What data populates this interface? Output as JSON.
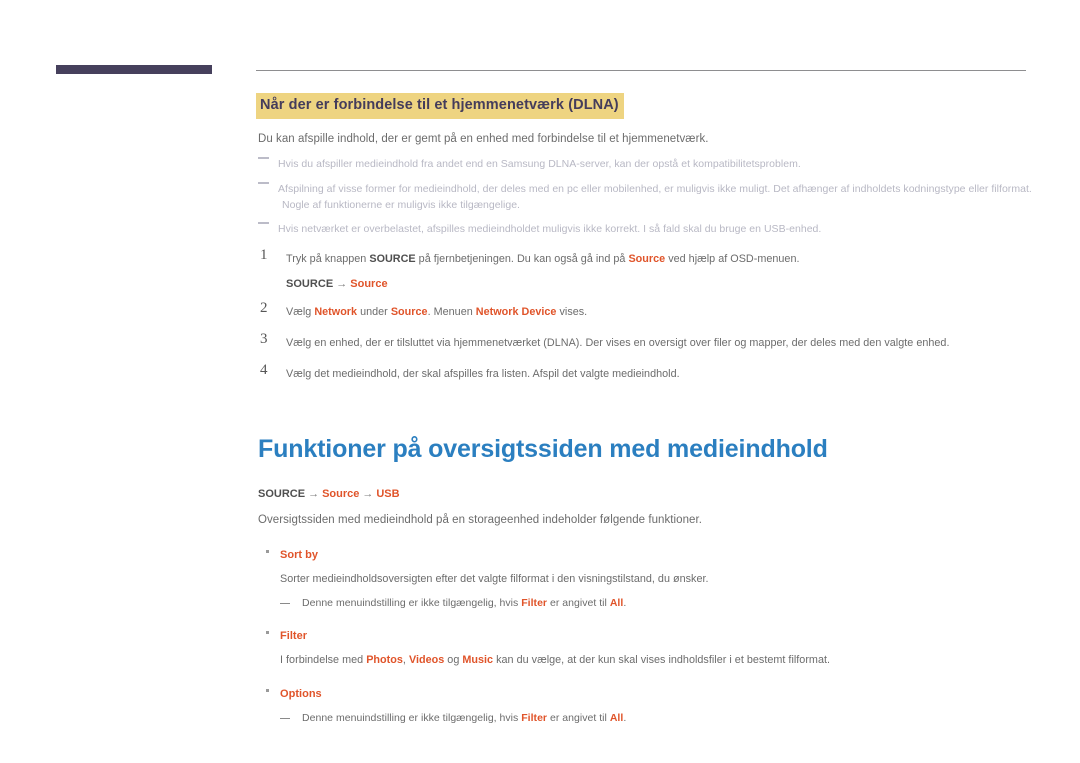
{
  "page": {
    "language": "da",
    "accent_color": "#e0542a",
    "heading_color": "#2b7fc0",
    "highlight_bg": "#eed481",
    "highlight_text_color": "#443c5b",
    "tab_bar_color": "#46405c"
  },
  "section_dlna": {
    "heading": "Når der er forbindelse til et hjemmenetværk (DLNA)",
    "intro": "Du kan afspille indhold, der er gemt på en enhed med forbindelse til et hjemmenetværk.",
    "notes": [
      {
        "text": "Hvis du afspiller medieindhold fra andet end en Samsung DLNA-server, kan der opstå et kompatibilitetsproblem.",
        "continuation": ""
      },
      {
        "text": "Afspilning af visse former for medieindhold, der deles med en pc eller mobilenhed, er muligvis ikke muligt. Det afhænger af indholdets kodningstype eller filformat.",
        "continuation": "Nogle af funktionerne er muligvis ikke tilgængelige."
      },
      {
        "text": "Hvis netværket er overbelastet, afspilles medieindholdet muligvis ikke korrekt. I så fald skal du bruge en USB-enhed.",
        "continuation": ""
      }
    ],
    "steps": [
      {
        "num": "1",
        "parts": [
          {
            "t": "Tryk på knappen ",
            "s": "plain"
          },
          {
            "t": "SOURCE",
            "s": "dark-bold"
          },
          {
            "t": " på fjernbetjeningen. Du kan også gå ind på ",
            "s": "plain"
          },
          {
            "t": "Source",
            "s": "accent-bold"
          },
          {
            "t": " ved hjælp af OSD-menuen.",
            "s": "plain"
          }
        ],
        "path": [
          {
            "t": "SOURCE",
            "s": "dark-bold"
          },
          {
            "t": "→",
            "s": "arrow"
          },
          {
            "t": "Source",
            "s": "accent-bold"
          }
        ]
      },
      {
        "num": "2",
        "parts": [
          {
            "t": "Vælg ",
            "s": "plain"
          },
          {
            "t": "Network",
            "s": "accent-bold"
          },
          {
            "t": " under ",
            "s": "plain"
          },
          {
            "t": "Source",
            "s": "accent-bold"
          },
          {
            "t": ". Menuen ",
            "s": "plain"
          },
          {
            "t": "Network Device",
            "s": "accent-bold"
          },
          {
            "t": " vises.",
            "s": "plain"
          }
        ],
        "path": []
      },
      {
        "num": "3",
        "parts": [
          {
            "t": "Vælg en enhed, der er tilsluttet via hjemmenetværket (DLNA). Der vises en oversigt over filer og mapper, der deles med den valgte enhed.",
            "s": "plain"
          }
        ],
        "path": []
      },
      {
        "num": "4",
        "parts": [
          {
            "t": "Vælg det medieindhold, der skal afspilles fra listen. Afspil det valgte medieindhold.",
            "s": "plain"
          }
        ],
        "path": []
      }
    ]
  },
  "section_overview": {
    "heading": "Funktioner på oversigtssiden med medieindhold",
    "path": [
      {
        "t": "SOURCE",
        "s": "dark-bold"
      },
      {
        "t": "→",
        "s": "arrow"
      },
      {
        "t": "Source",
        "s": "accent-bold"
      },
      {
        "t": "→",
        "s": "arrow"
      },
      {
        "t": "USB",
        "s": "accent-bold"
      }
    ],
    "intro": "Oversigtssiden med medieindhold på en storageenhed indeholder følgende funktioner.",
    "bullets": [
      {
        "title": "Sort by",
        "desc_parts": [
          {
            "t": "Sorter medieindholdsoversigten efter det valgte filformat i den visningstilstand, du ønsker.",
            "s": "plain"
          }
        ],
        "subdashes": [
          [
            {
              "t": "Denne menuindstilling er ikke tilgængelig, hvis ",
              "s": "plain"
            },
            {
              "t": "Filter",
              "s": "accent-bold"
            },
            {
              "t": " er angivet til ",
              "s": "plain"
            },
            {
              "t": "All",
              "s": "accent-bold"
            },
            {
              "t": ".",
              "s": "plain"
            }
          ]
        ]
      },
      {
        "title": "Filter",
        "desc_parts": [
          {
            "t": "I forbindelse med ",
            "s": "plain"
          },
          {
            "t": "Photos",
            "s": "accent-bold"
          },
          {
            "t": ", ",
            "s": "plain"
          },
          {
            "t": "Videos",
            "s": "accent-bold"
          },
          {
            "t": " og ",
            "s": "plain"
          },
          {
            "t": "Music",
            "s": "accent-bold"
          },
          {
            "t": " kan du vælge, at der kun skal vises indholdsfiler i et bestemt filformat.",
            "s": "plain"
          }
        ],
        "subdashes": []
      },
      {
        "title": "Options",
        "desc_parts": [],
        "subdashes": [
          [
            {
              "t": "Denne menuindstilling er ikke tilgængelig, hvis ",
              "s": "plain"
            },
            {
              "t": "Filter",
              "s": "accent-bold"
            },
            {
              "t": " er angivet til ",
              "s": "plain"
            },
            {
              "t": "All",
              "s": "accent-bold"
            },
            {
              "t": ".",
              "s": "plain"
            }
          ]
        ]
      }
    ]
  }
}
